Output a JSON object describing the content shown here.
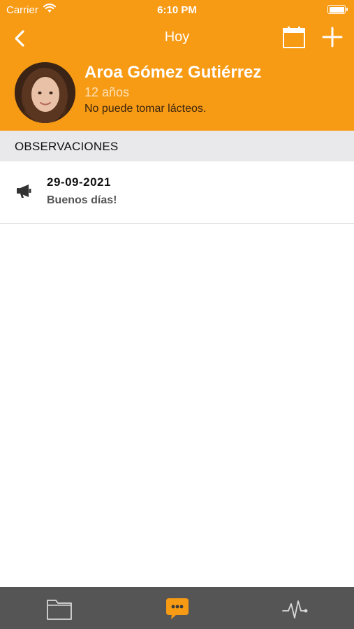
{
  "status_bar": {
    "carrier": "Carrier",
    "time": "6:10 PM"
  },
  "nav": {
    "title": "Hoy",
    "back_icon": "chevron-left-icon",
    "calendar_icon": "calendar-icon",
    "add_icon": "plus-icon"
  },
  "profile": {
    "name": "Aroa Gómez Gutiérrez",
    "age": "12 años",
    "note": "No puede tomar lácteos."
  },
  "section": {
    "title": "OBSERVACIONES"
  },
  "observations": [
    {
      "icon": "megaphone-icon",
      "date": "29-09-2021",
      "text": "Buenos días!"
    }
  ],
  "tabs": [
    {
      "icon": "folder-icon",
      "active": false
    },
    {
      "icon": "chat-bubble-icon",
      "active": true
    },
    {
      "icon": "heartbeat-icon",
      "active": false
    }
  ],
  "colors": {
    "accent": "#f79a14",
    "tab_bar": "#555555",
    "section_bg": "#e9e9ec"
  }
}
